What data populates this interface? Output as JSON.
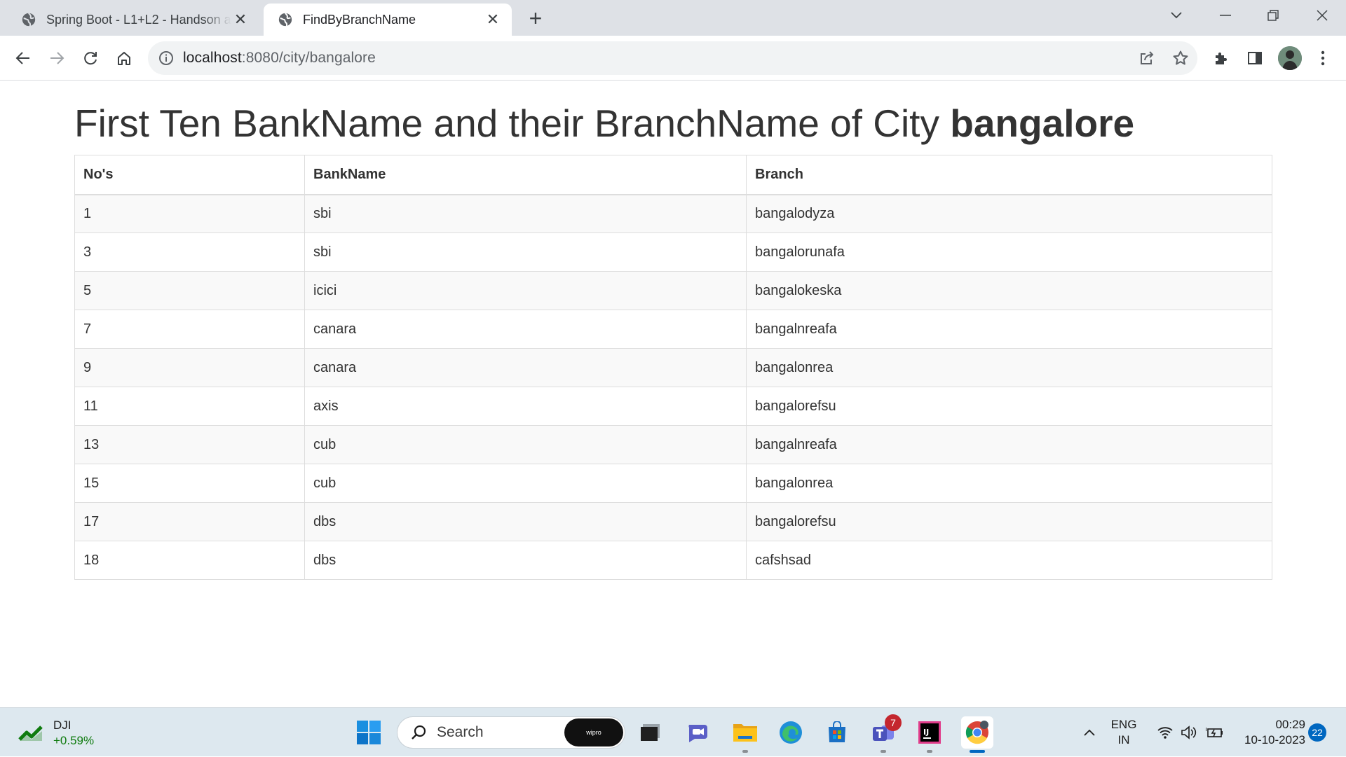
{
  "browser": {
    "tabs": [
      {
        "title": "Spring Boot - L1+L2 - Handson a",
        "close": "✕"
      },
      {
        "title": "FindByBranchName",
        "close": "✕"
      }
    ],
    "new_tab": "+",
    "url_host": "localhost",
    "url_rest": ":8080/city/bangalore"
  },
  "page": {
    "heading_prefix": "First Ten BankName and their BranchName of City ",
    "heading_city": "bangalore",
    "table": {
      "headers": [
        "No's",
        "BankName",
        "Branch"
      ],
      "rows": [
        [
          "1",
          "sbi",
          "bangalodyza"
        ],
        [
          "3",
          "sbi",
          "bangalorunafa"
        ],
        [
          "5",
          "icici",
          "bangalokeska"
        ],
        [
          "7",
          "canara",
          "bangalnreafa"
        ],
        [
          "9",
          "canara",
          "bangalonrea"
        ],
        [
          "11",
          "axis",
          "bangalorefsu"
        ],
        [
          "13",
          "cub",
          "bangalnreafa"
        ],
        [
          "15",
          "cub",
          "bangalonrea"
        ],
        [
          "17",
          "dbs",
          "bangalorefsu"
        ],
        [
          "18",
          "dbs",
          "cafshsad"
        ]
      ]
    }
  },
  "taskbar": {
    "stock_name": "DJI",
    "stock_change": "+0.59%",
    "search_label": "Search",
    "search_badge": "wipro",
    "teams_badge": "7",
    "lang": "ENG",
    "region": "IN",
    "time": "00:29",
    "date": "10-10-2023",
    "notification_count": "22",
    "colors": {
      "accent": "#0067c0",
      "stock_up": "#0f7b0f"
    }
  }
}
